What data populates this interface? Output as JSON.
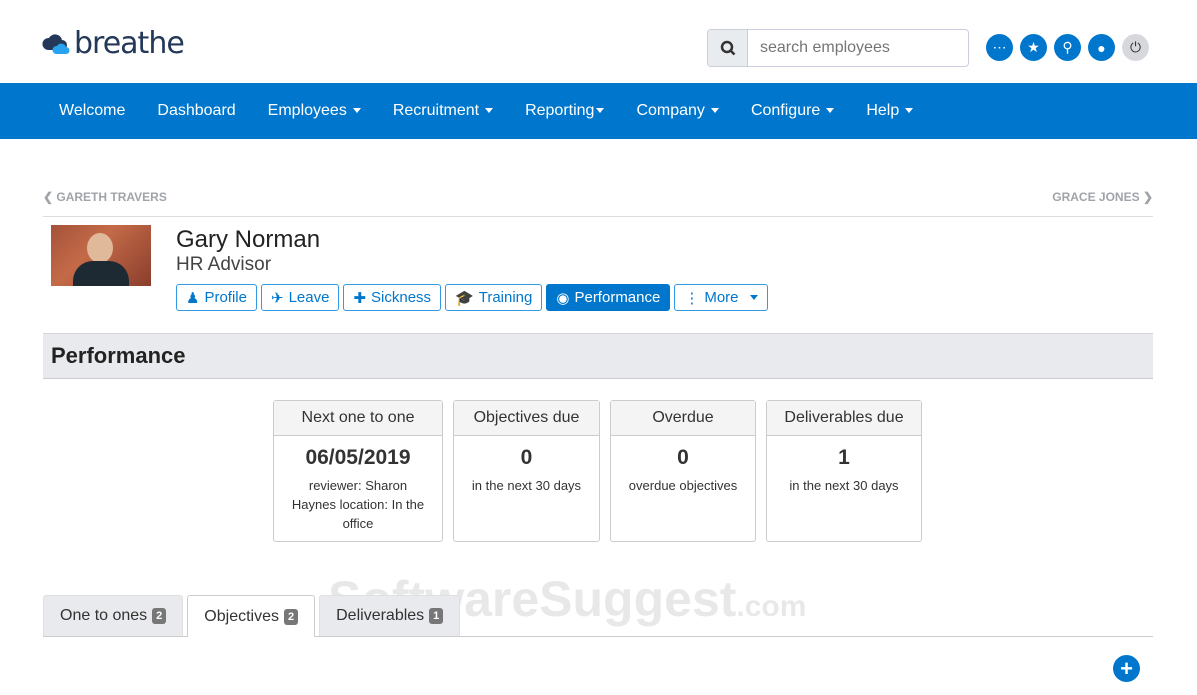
{
  "brand": {
    "name": "breathe"
  },
  "search": {
    "placeholder": "search employees"
  },
  "nav": [
    "Welcome",
    "Dashboard",
    "Employees",
    "Recruitment",
    "Reporting",
    "Company",
    "Configure",
    "Help"
  ],
  "prev_employee": "GARETH TRAVERS",
  "next_employee": "GRACE JONES",
  "employee": {
    "name": "Gary Norman",
    "role": "HR Advisor"
  },
  "profile_tabs": [
    "Profile",
    "Leave",
    "Sickness",
    "Training",
    "Performance",
    "More"
  ],
  "section_title": "Performance",
  "cards": [
    {
      "title": "Next one to one",
      "value": "06/05/2019",
      "sub": "reviewer: Sharon Haynes location: In the office"
    },
    {
      "title": "Objectives due",
      "value": "0",
      "sub": "in the next 30 days"
    },
    {
      "title": "Overdue",
      "value": "0",
      "sub": "overdue objectives"
    },
    {
      "title": "Deliverables due",
      "value": "1",
      "sub": "in the next 30 days"
    }
  ],
  "tabs": [
    {
      "label": "One to ones",
      "count": "2"
    },
    {
      "label": "Objectives",
      "count": "2"
    },
    {
      "label": "Deliverables",
      "count": "1"
    }
  ],
  "watermark": {
    "main": "SoftwareSuggest",
    "suffix": ".com"
  }
}
